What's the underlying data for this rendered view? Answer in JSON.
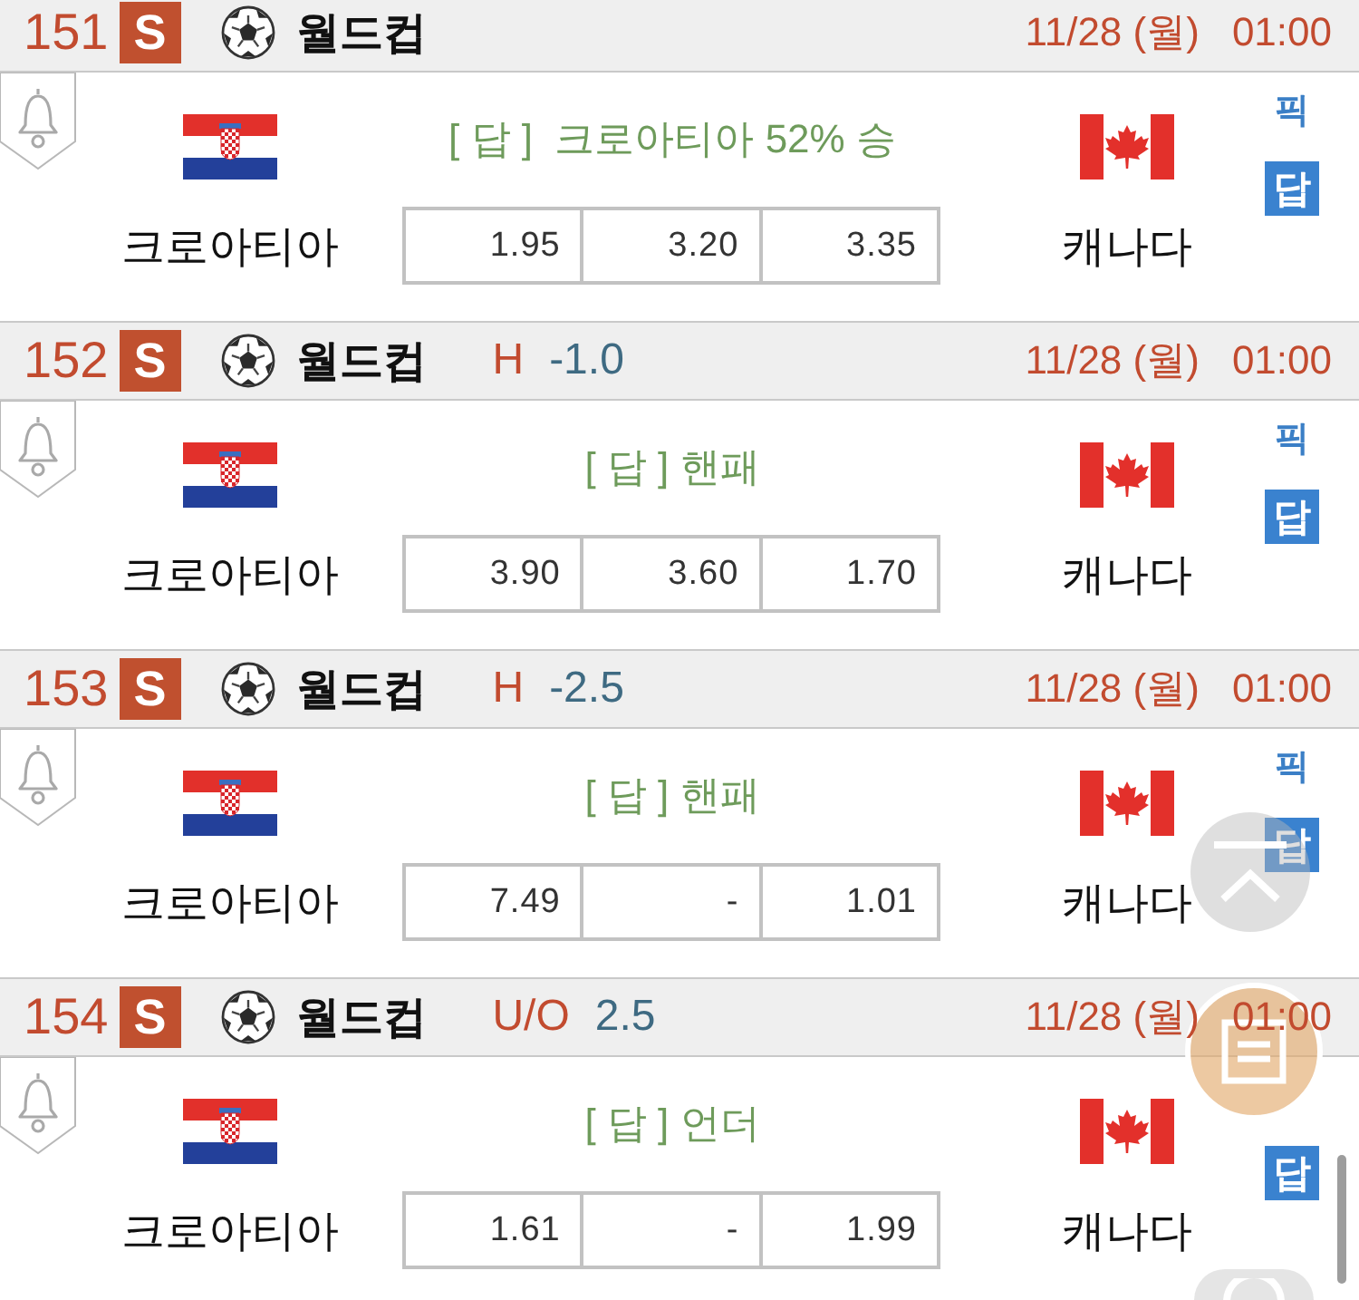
{
  "matches": [
    {
      "number": "151",
      "badge": "S",
      "league": "월드컵",
      "date": "11/28 (월)",
      "time": "01:00",
      "tip": "[ 답 ]  크로아티아 52% 승",
      "home": "크로아티아",
      "away": "캐나다",
      "odds": [
        "1.95",
        "3.20",
        "3.35"
      ],
      "pick_label": "픽",
      "answer_label": "답"
    },
    {
      "number": "152",
      "badge": "S",
      "league": "월드컵",
      "market": {
        "label": "H",
        "line": "-1.0"
      },
      "date": "11/28 (월)",
      "time": "01:00",
      "tip": "[ 답 ] 핸패",
      "home": "크로아티아",
      "away": "캐나다",
      "odds": [
        "3.90",
        "3.60",
        "1.70"
      ],
      "pick_label": "픽",
      "answer_label": "답"
    },
    {
      "number": "153",
      "badge": "S",
      "league": "월드컵",
      "market": {
        "label": "H",
        "line": "-2.5"
      },
      "date": "11/28 (월)",
      "time": "01:00",
      "tip": "[ 답 ] 핸패",
      "home": "크로아티아",
      "away": "캐나다",
      "odds": [
        "7.49",
        "-",
        "1.01"
      ],
      "pick_label": "픽",
      "answer_label": "답"
    },
    {
      "number": "154",
      "badge": "S",
      "league": "월드컵",
      "market": {
        "label": "U/O",
        "line": "2.5"
      },
      "date": "11/28 (월)",
      "time": "01:00",
      "tip": "[ 답 ] 언더",
      "home": "크로아티아",
      "away": "캐나다",
      "odds": [
        "1.61",
        "-",
        "1.99"
      ],
      "answer_label": "답"
    }
  ]
}
